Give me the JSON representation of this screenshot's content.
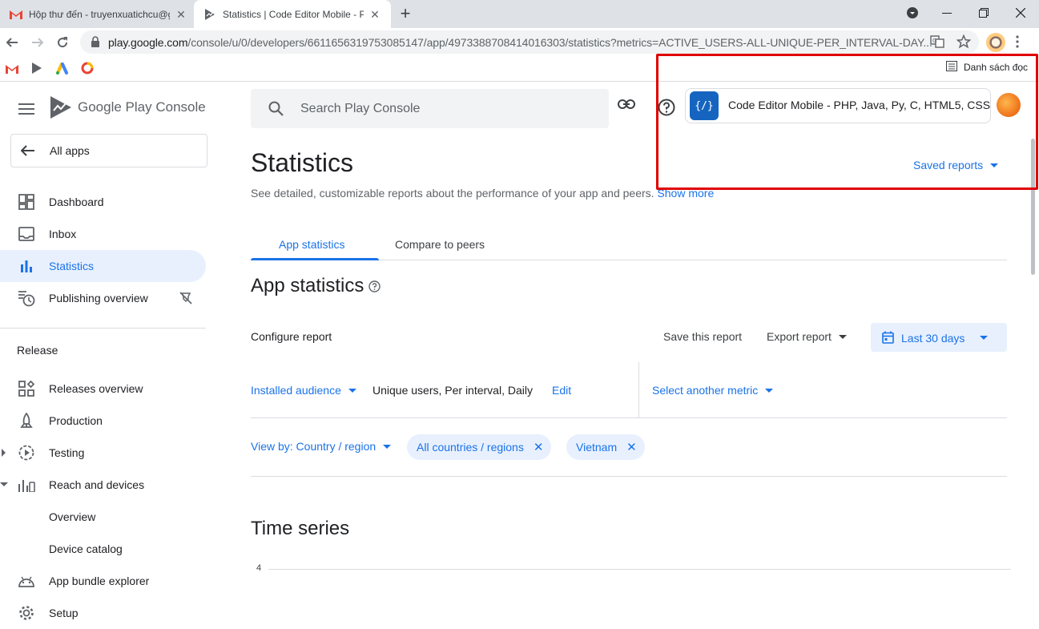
{
  "browser": {
    "tabs": [
      {
        "title": "Hộp thư đến - truyenxuatichcu@gmail.com"
      },
      {
        "title": "Statistics | Code Editor Mobile - PHP, Java, Py"
      }
    ],
    "url": {
      "host": "play.google.com",
      "path": "/console/u/0/developers/6611656319753085147/app/4973388708414016303/statistics?metrics=ACTIVE_USERS-ALL-UNIQUE-PER_INTERVAL-DAY..."
    },
    "reading_list": "Danh sách đọc"
  },
  "sidebar": {
    "logo_text": "Google Play Console",
    "back_label": "All apps",
    "items": [
      {
        "label": "Dashboard"
      },
      {
        "label": "Inbox"
      },
      {
        "label": "Statistics"
      },
      {
        "label": "Publishing overview"
      }
    ],
    "release_label": "Release",
    "release_items": [
      {
        "label": "Releases overview"
      },
      {
        "label": "Production"
      },
      {
        "label": "Testing"
      },
      {
        "label": "Reach and devices"
      },
      {
        "label": "Overview"
      },
      {
        "label": "Device catalog"
      },
      {
        "label": "App bundle explorer"
      },
      {
        "label": "Setup"
      }
    ]
  },
  "header": {
    "search_placeholder": "Search Play Console",
    "app_name": "Code Editor Mobile - PHP, Java, Py, C, HTML5, CSS",
    "app_icon_text": "{/}"
  },
  "page": {
    "title": "Statistics",
    "description": "See detailed, customizable reports about the performance of your app and peers.",
    "show_more": "Show more",
    "saved_reports": "Saved reports",
    "tabs": [
      {
        "label": "App statistics"
      },
      {
        "label": "Compare to peers"
      }
    ],
    "section_title": "App statistics",
    "configure_label": "Configure report",
    "save_report": "Save this report",
    "export_report": "Export report",
    "date_range": "Last 30 days",
    "metric": {
      "name": "Installed audience",
      "description": "Unique users, Per interval, Daily",
      "edit": "Edit",
      "select_other": "Select another metric"
    },
    "filters": {
      "view_by": "View by: Country / region",
      "chips": [
        {
          "label": "All countries / regions"
        },
        {
          "label": "Vietnam"
        }
      ]
    },
    "time_series_title": "Time series",
    "y_tick": "4"
  },
  "colors": {
    "accent": "#1a73e8",
    "highlight_box": "#e00000"
  }
}
